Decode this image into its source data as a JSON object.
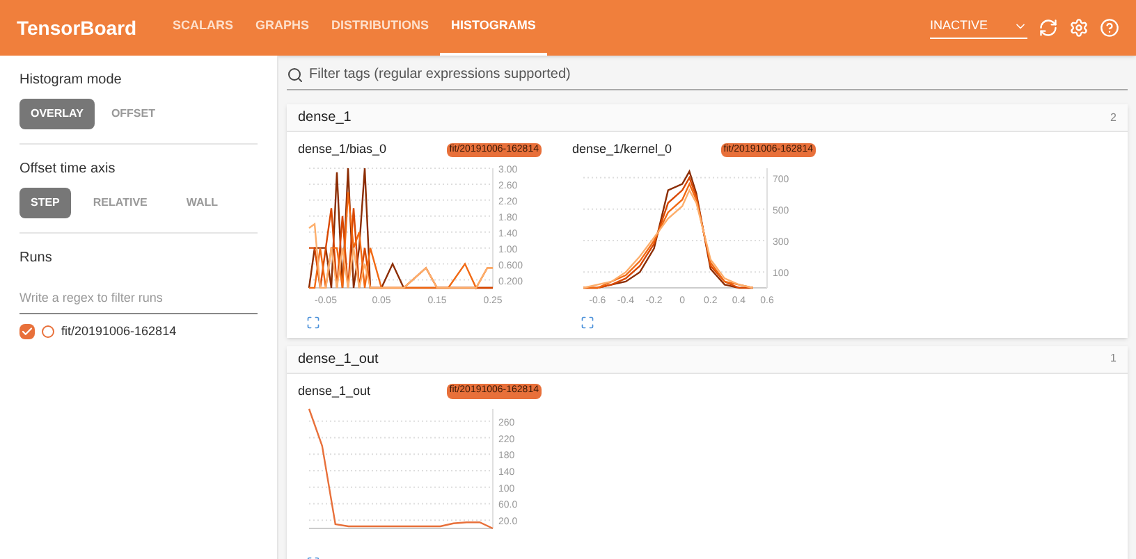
{
  "header": {
    "title": "TensorBoard",
    "tabs": [
      {
        "label": "SCALARS",
        "selected": false
      },
      {
        "label": "GRAPHS",
        "selected": false
      },
      {
        "label": "DISTRIBUTIONS",
        "selected": false
      },
      {
        "label": "HISTOGRAMS",
        "selected": true
      }
    ],
    "run_status": "INACTIVE"
  },
  "sidebar": {
    "groups": [
      {
        "label": "Histogram mode",
        "options": [
          {
            "label": "OVERLAY",
            "selected": true
          },
          {
            "label": "OFFSET",
            "selected": false
          }
        ]
      },
      {
        "label": "Offset time axis",
        "options": [
          {
            "label": "STEP",
            "selected": true
          },
          {
            "label": "RELATIVE",
            "selected": false
          },
          {
            "label": "WALL",
            "selected": false
          }
        ]
      }
    ],
    "runs": {
      "label": "Runs",
      "placeholder": "Write a regex to filter runs",
      "items": [
        {
          "name": "fit/20191006-162814",
          "checked": true,
          "color": "#e8703a"
        }
      ]
    }
  },
  "filter": {
    "placeholder": "Filter tags (regular expressions supported)"
  },
  "sections": [
    {
      "title": "dense_1",
      "count": "2",
      "cards": [
        {
          "title": "dense_1/bias_0",
          "run": "fit/20191006-162814",
          "chart_data": {
            "type": "line",
            "grid": true,
            "x": [
              -0.08,
              -0.07,
              -0.06,
              -0.05,
              -0.04,
              -0.03,
              -0.02,
              -0.01,
              0,
              0.01,
              0.02,
              0.03,
              0.05,
              0.07,
              0.09,
              0.13,
              0.15,
              0.17,
              0.2,
              0.22,
              0.24,
              0.25
            ],
            "series": [
              {
                "color": "#8c2d04",
                "values": [
                  0,
                  1,
                  1,
                  1,
                  0,
                  2.9,
                  0,
                  3,
                  0,
                  1,
                  3,
                  0,
                  0,
                  0.6,
                  0,
                  0,
                  0,
                  0,
                  0,
                  0,
                  0,
                  0
                ]
              },
              {
                "color": "#d94801",
                "values": [
                  1,
                  1,
                  0,
                  1,
                  2,
                  0,
                  1.8,
                  0,
                  2,
                  0,
                  1,
                  0,
                  0,
                  0,
                  0,
                  0.5,
                  0,
                  0,
                  0,
                  0,
                  0,
                  0
                ]
              },
              {
                "color": "#f16913",
                "values": [
                  0,
                  0,
                  1,
                  0,
                  1,
                  1,
                  0,
                  2.4,
                  1,
                  1.4,
                  0,
                  1,
                  0,
                  0,
                  0,
                  0,
                  0,
                  0,
                  0.6,
                  0,
                  0.5,
                  0.5
                ]
              },
              {
                "color": "#fdae6b",
                "values": [
                  1.5,
                  1.6,
                  0,
                  0,
                  1,
                  0,
                  1,
                  0,
                  1,
                  0,
                  0.6,
                  0,
                  0,
                  0,
                  0,
                  0.5,
                  0,
                  0,
                  0,
                  0,
                  0.5,
                  0.5
                ]
              }
            ],
            "xlim": [
              -0.08,
              0.25
            ],
            "ylim": [
              0,
              3
            ],
            "xticks": [
              -0.05,
              0.05,
              0.15,
              0.25
            ],
            "yticks": [
              {
                "value": 0.2,
                "label": "0.200"
              },
              {
                "value": 0.6,
                "label": "0.600"
              },
              {
                "value": 1,
                "label": "1.00"
              },
              {
                "value": 1.4,
                "label": "1.40"
              },
              {
                "value": 1.8,
                "label": "1.80"
              },
              {
                "value": 2.2,
                "label": "2.20"
              },
              {
                "value": 2.6,
                "label": "2.60"
              },
              {
                "value": 3,
                "label": "3.00"
              }
            ]
          }
        },
        {
          "title": "dense_1/kernel_0",
          "run": "fit/20191006-162814",
          "chart_data": {
            "type": "line",
            "grid": true,
            "x": [
              -0.7,
              -0.6,
              -0.5,
              -0.4,
              -0.3,
              -0.2,
              -0.1,
              0,
              0.05,
              0.1,
              0.2,
              0.3,
              0.4,
              0.5
            ],
            "series": [
              {
                "color": "#8c2d04",
                "values": [
                  0,
                  0,
                  20,
                  40,
                  100,
                  250,
                  620,
                  660,
                  740,
                  600,
                  120,
                  20,
                  0,
                  0
                ]
              },
              {
                "color": "#d94801",
                "values": [
                  0,
                  0,
                  20,
                  60,
                  140,
                  280,
                  540,
                  620,
                  700,
                  580,
                  140,
                  40,
                  0,
                  0
                ]
              },
              {
                "color": "#f16913",
                "values": [
                  0,
                  0,
                  40,
                  80,
                  170,
                  300,
                  480,
                  560,
                  660,
                  560,
                  160,
                  40,
                  20,
                  0
                ]
              },
              {
                "color": "#fdae6b",
                "values": [
                  0,
                  20,
                  40,
                  100,
                  200,
                  320,
                  440,
                  520,
                  620,
                  540,
                  180,
                  60,
                  20,
                  0
                ]
              }
            ],
            "xlim": [
              -0.7,
              0.6
            ],
            "ylim": [
              0,
              760
            ],
            "xticks": [
              -0.6,
              -0.4,
              -0.2,
              0,
              0.2,
              0.4,
              0.6
            ],
            "yticks": [
              100,
              300,
              500,
              700
            ]
          }
        }
      ]
    },
    {
      "title": "dense_1_out",
      "count": "1",
      "cards": [
        {
          "title": "dense_1_out",
          "run": "fit/20191006-162814",
          "chart_data": {
            "type": "line",
            "grid": true,
            "categories": [
              null,
              null,
              null,
              null,
              null,
              null,
              null,
              null,
              null,
              null,
              null,
              null,
              null,
              null,
              null
            ],
            "series": [
              {
                "color": "#e8703a",
                "values": [
                  290,
                  200,
                  10,
                  5,
                  5,
                  5,
                  5,
                  5,
                  5,
                  5,
                  5,
                  12,
                  15,
                  15,
                  0
                ]
              }
            ],
            "ylim": [
              0,
              290
            ],
            "yticks": [
              {
                "value": 20,
                "label": "20.0"
              },
              {
                "value": 60,
                "label": "60.0"
              },
              {
                "value": 100,
                "label": "100"
              },
              {
                "value": 140,
                "label": "140"
              },
              {
                "value": 180,
                "label": "180"
              },
              {
                "value": 220,
                "label": "220"
              },
              {
                "value": 260,
                "label": "260"
              }
            ]
          }
        }
      ]
    }
  ]
}
